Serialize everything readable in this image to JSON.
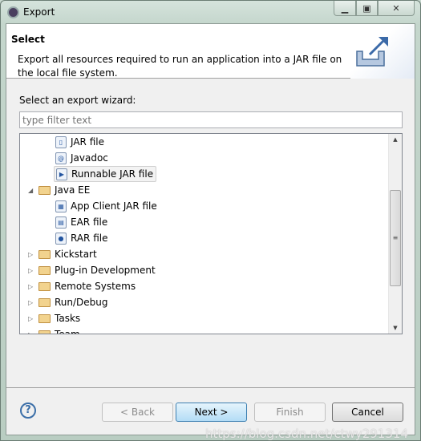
{
  "window": {
    "title": "Export",
    "controls": [
      "minimize",
      "maximize",
      "close"
    ]
  },
  "header": {
    "title": "Select",
    "description": "Export all resources required to run an application into a JAR file on the local file system.",
    "icon": "export-wizard-icon"
  },
  "wizard": {
    "label": "Select an export wizard:",
    "filter_placeholder": "type filter text",
    "filter_value": ""
  },
  "tree": {
    "items": [
      {
        "label": "JAR file",
        "level": 1,
        "icon": "jar-icon"
      },
      {
        "label": "Javadoc",
        "level": 1,
        "icon": "javadoc-icon"
      },
      {
        "label": "Runnable JAR file",
        "level": 1,
        "icon": "runnable-jar-icon",
        "selected": true
      },
      {
        "label": "Java EE",
        "level": 0,
        "icon": "folder-icon",
        "expanded": true
      },
      {
        "label": "App Client JAR file",
        "level": 1,
        "icon": "app-client-icon"
      },
      {
        "label": "EAR file",
        "level": 1,
        "icon": "ear-icon"
      },
      {
        "label": "RAR file",
        "level": 1,
        "icon": "rar-icon"
      },
      {
        "label": "Kickstart",
        "level": 0,
        "icon": "folder-icon",
        "expanded": false
      },
      {
        "label": "Plug-in Development",
        "level": 0,
        "icon": "folder-icon",
        "expanded": false
      },
      {
        "label": "Remote Systems",
        "level": 0,
        "icon": "folder-icon",
        "expanded": false
      },
      {
        "label": "Run/Debug",
        "level": 0,
        "icon": "folder-icon",
        "expanded": false
      },
      {
        "label": "Tasks",
        "level": 0,
        "icon": "folder-icon",
        "expanded": false
      },
      {
        "label": "Team",
        "level": 0,
        "icon": "folder-icon",
        "expanded": false
      }
    ]
  },
  "buttons": {
    "back": "< Back",
    "next": "Next >",
    "finish": "Finish",
    "cancel": "Cancel",
    "help": "?"
  },
  "watermark": "https://blog.csdn.net/ctwy291314"
}
